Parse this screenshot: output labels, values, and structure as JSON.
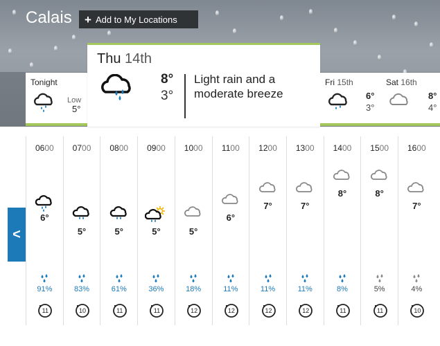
{
  "header": {
    "city": "Calais",
    "add_location_label": "Add to My Locations"
  },
  "tonight": {
    "label": "Tonight",
    "low_label": "Low",
    "low_value": "5°",
    "icon": "light-rain-cloud-icon"
  },
  "active_day": {
    "day": "Thu",
    "date": "14th",
    "high": "8°",
    "low": "3°",
    "description": "Light rain and a moderate breeze",
    "icon": "light-rain-cloud-icon"
  },
  "fri": {
    "day": "Fri",
    "date": "15th",
    "high": "6°",
    "low": "3°",
    "icon": "light-rain-cloud-icon"
  },
  "sat": {
    "day": "Sat",
    "date": "16th",
    "high": "8°",
    "low": "4°",
    "icon": "cloud-icon"
  },
  "hourly": [
    {
      "hh": "06",
      "mm": "00",
      "temp": "6°",
      "icon": "light-rain-cloud-icon",
      "rain": "91%",
      "wind": "11"
    },
    {
      "hh": "07",
      "mm": "00",
      "temp": "5°",
      "icon": "cloud-outline-icon",
      "rain": "83%",
      "wind": "10"
    },
    {
      "hh": "08",
      "mm": "00",
      "temp": "5°",
      "icon": "cloud-outline-icon",
      "rain": "61%",
      "wind": "11"
    },
    {
      "hh": "09",
      "mm": "00",
      "temp": "5°",
      "icon": "sun-cloud-icon",
      "rain": "36%",
      "wind": "11"
    },
    {
      "hh": "10",
      "mm": "00",
      "temp": "5°",
      "icon": "grey-cloud-icon",
      "rain": "18%",
      "wind": "12"
    },
    {
      "hh": "11",
      "mm": "00",
      "temp": "6°",
      "icon": "grey-cloud-icon",
      "rain": "11%",
      "wind": "12"
    },
    {
      "hh": "12",
      "mm": "00",
      "temp": "7°",
      "icon": "grey-cloud-icon",
      "rain": "11%",
      "wind": "12"
    },
    {
      "hh": "13",
      "mm": "00",
      "temp": "7°",
      "icon": "grey-cloud-icon",
      "rain": "11%",
      "wind": "12"
    },
    {
      "hh": "14",
      "mm": "00",
      "temp": "8°",
      "icon": "grey-cloud-icon",
      "rain": "8%",
      "wind": "11"
    },
    {
      "hh": "15",
      "mm": "00",
      "temp": "8°",
      "icon": "grey-cloud-icon",
      "rain": "5%",
      "wind": "11"
    },
    {
      "hh": "16",
      "mm": "00",
      "temp": "7°",
      "icon": "grey-cloud-icon",
      "rain": "4%",
      "wind": "10"
    }
  ],
  "colors": {
    "accent_green": "#a4c85b",
    "rain_blue": "#1c7ab9",
    "low_rain_grey": "#888888"
  },
  "nav": {
    "prev_arrow": "<"
  }
}
